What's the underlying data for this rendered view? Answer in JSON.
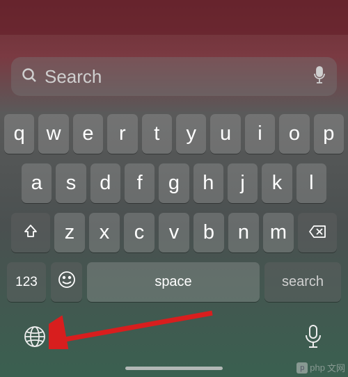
{
  "search": {
    "placeholder": "Search"
  },
  "keyboard": {
    "row1": [
      "q",
      "w",
      "e",
      "r",
      "t",
      "y",
      "u",
      "i",
      "o",
      "p"
    ],
    "row2": [
      "a",
      "s",
      "d",
      "f",
      "g",
      "h",
      "j",
      "k",
      "l"
    ],
    "row3": [
      "z",
      "x",
      "c",
      "v",
      "b",
      "n",
      "m"
    ],
    "numbers_label": "123",
    "space_label": "space",
    "action_label": "search"
  },
  "watermark": {
    "text": "php",
    "suffix": "文网"
  }
}
